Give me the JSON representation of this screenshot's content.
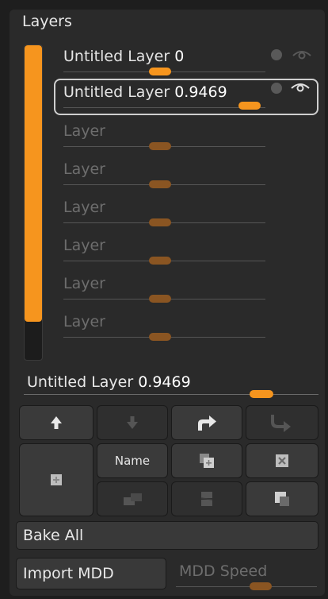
{
  "panel": {
    "title": "Layers"
  },
  "layer_strength_bar": {
    "fill_fraction": 0.88
  },
  "layers": [
    {
      "name": "Untitled Layer",
      "value": "0",
      "slider_fraction": 0.48,
      "active": true,
      "selected": false
    },
    {
      "name": "Untitled Layer",
      "value": "0.9469",
      "slider_fraction": 0.92,
      "active": true,
      "selected": true
    },
    {
      "name": "Layer",
      "value": "",
      "slider_fraction": 0.48,
      "active": false,
      "selected": false
    },
    {
      "name": "Layer",
      "value": "",
      "slider_fraction": 0.48,
      "active": false,
      "selected": false
    },
    {
      "name": "Layer",
      "value": "",
      "slider_fraction": 0.48,
      "active": false,
      "selected": false
    },
    {
      "name": "Layer",
      "value": "",
      "slider_fraction": 0.48,
      "active": false,
      "selected": false
    },
    {
      "name": "Layer",
      "value": "",
      "slider_fraction": 0.48,
      "active": false,
      "selected": false
    },
    {
      "name": "Layer",
      "value": "",
      "slider_fraction": 0.48,
      "active": false,
      "selected": false
    }
  ],
  "current_layer": {
    "name": "Untitled Layer",
    "value": "0.9469",
    "slider_fraction": 0.9469
  },
  "buttons": {
    "move_up": "arrow-up-icon",
    "move_down": "arrow-down-icon",
    "transfer_up": "turn-right-icon",
    "transfer_down": "turn-down-right-icon",
    "new_layer": "new-layer-icon",
    "name_label": "Name",
    "duplicate": "duplicate-icon",
    "delete": "delete-icon",
    "merge_down": "merge-down-icon",
    "split": "split-icon",
    "copy": "copy-icon"
  },
  "bake_all": "Bake All",
  "import_mdd": "Import MDD",
  "mdd_speed": {
    "label": "MDD Speed",
    "slider_fraction": 0.6
  },
  "colors": {
    "accent": "#f6951e",
    "accent_dim": "#8a5522",
    "panel_bg": "#2a2a2a",
    "button_bg": "#3a3a3a"
  }
}
